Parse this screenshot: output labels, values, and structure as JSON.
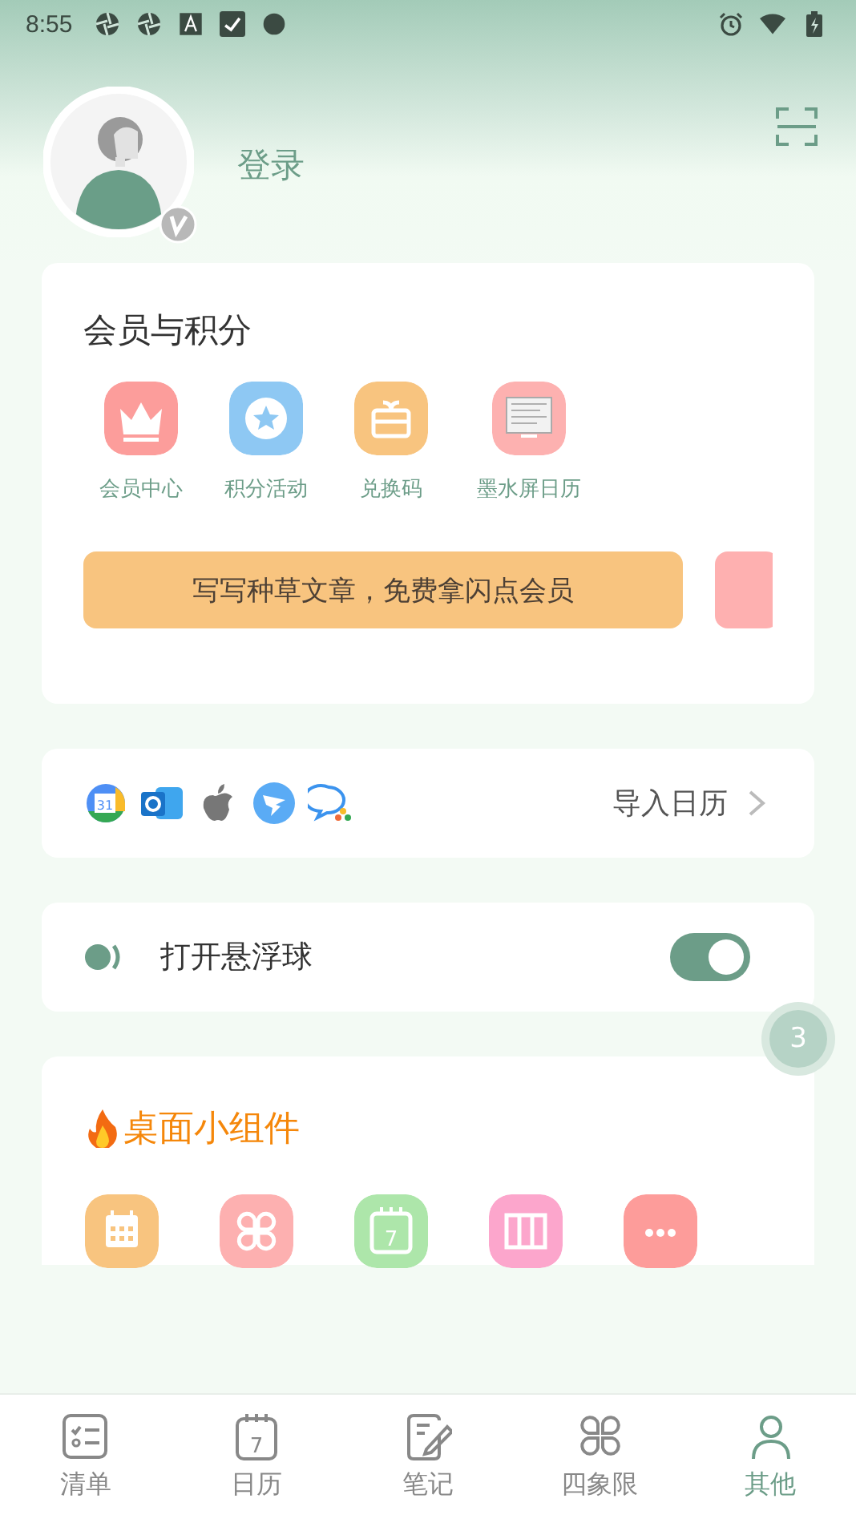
{
  "status_bar": {
    "time": "8:55"
  },
  "profile": {
    "login": "登录"
  },
  "membership": {
    "title": "会员与积分",
    "items": [
      {
        "kind": "crown",
        "label": "会员中心",
        "color": "#fc9d9b"
      },
      {
        "kind": "star",
        "label": "积分活动",
        "color": "#8ec8f3"
      },
      {
        "kind": "gift",
        "label": "兑换码",
        "color": "#f8c47f"
      },
      {
        "kind": "screen",
        "label": "墨水屏日历",
        "color": "#fdb1b0"
      }
    ],
    "banners": [
      {
        "text": "写写种草文章，免费拿闪点会员",
        "color": "#f8c47f"
      },
      {
        "color": "#feb0b0"
      }
    ]
  },
  "import": {
    "label": "导入日历",
    "sources": [
      {
        "kind": "google",
        "text": "31"
      },
      {
        "kind": "outlook"
      },
      {
        "kind": "apple"
      },
      {
        "kind": "dingtalk"
      },
      {
        "kind": "wecom"
      }
    ]
  },
  "float_ball": {
    "label": "打开悬浮球",
    "on": true
  },
  "float_badge": "3",
  "widgets": {
    "title": "桌面小组件",
    "items": [
      {
        "kind": "calendar",
        "color": "#f8c47f"
      },
      {
        "kind": "clover",
        "color": "#fdb0b0"
      },
      {
        "kind": "day",
        "color": "#ade6aa",
        "text": "7"
      },
      {
        "kind": "columns",
        "color": "#fca6cc"
      },
      {
        "kind": "more",
        "color": "#fd9c9a"
      }
    ]
  },
  "tabs": [
    {
      "kind": "list",
      "label": "清单",
      "selected": false
    },
    {
      "kind": "day",
      "label": "日历",
      "selected": false,
      "text": "7"
    },
    {
      "kind": "note",
      "label": "笔记",
      "selected": false
    },
    {
      "kind": "clover",
      "label": "四象限",
      "selected": false
    },
    {
      "kind": "other",
      "label": "其他",
      "selected": true
    }
  ]
}
